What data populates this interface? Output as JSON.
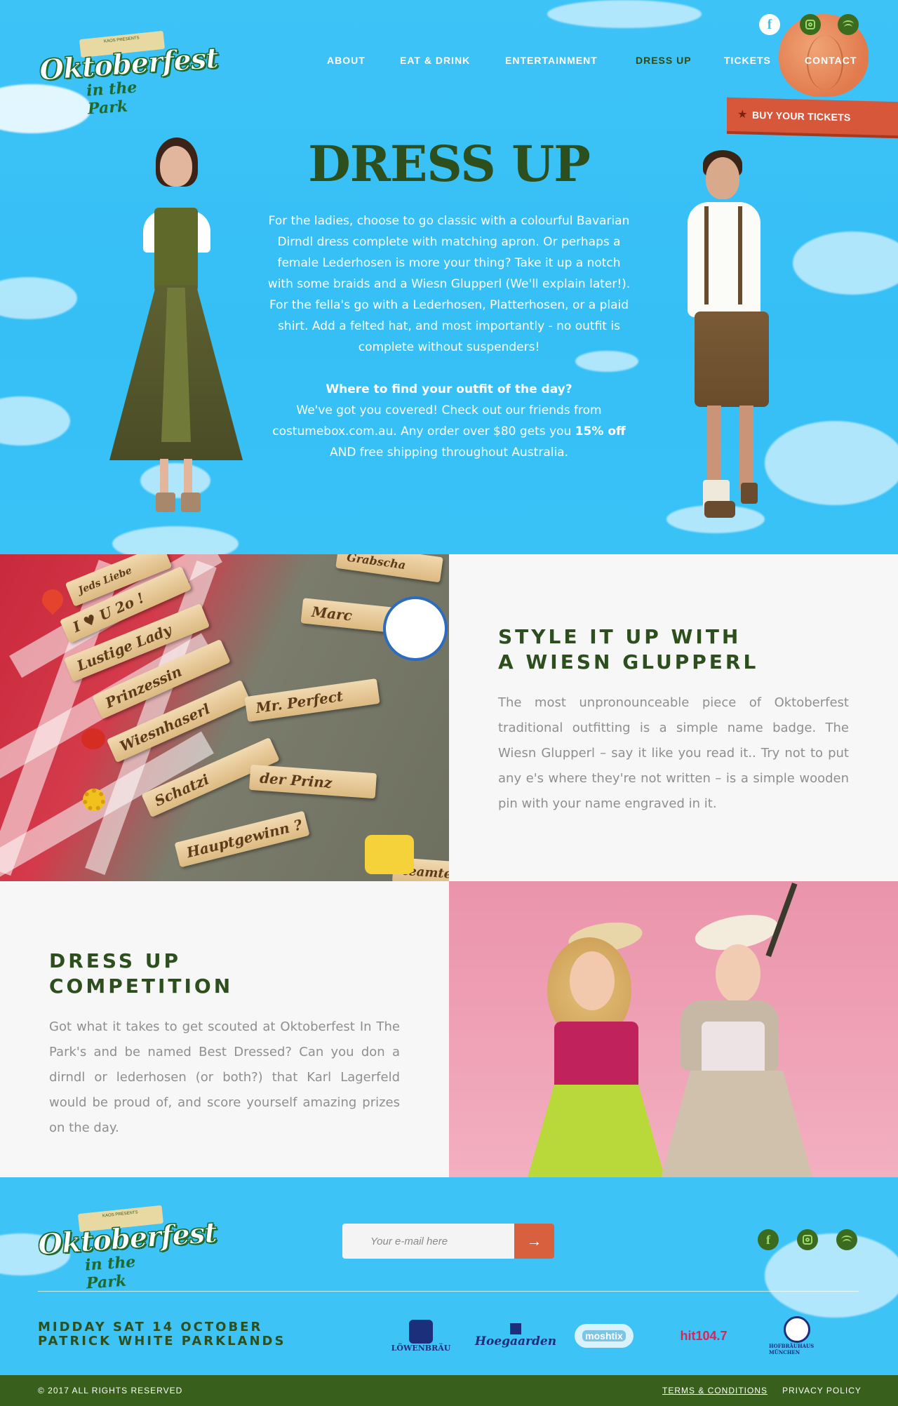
{
  "logo": {
    "brand_line": "KAOS PRESENTS",
    "word": "Oktoberfest",
    "sub": "in the Park"
  },
  "nav": {
    "items": [
      {
        "label": "ABOUT"
      },
      {
        "label": "EAT & DRINK"
      },
      {
        "label": "ENTERTAINMENT"
      },
      {
        "label": "DRESS UP"
      },
      {
        "label": "TICKETS"
      },
      {
        "label": "CONTACT"
      }
    ],
    "active": "DRESS UP",
    "buy_label": "BUY YOUR TICKETS"
  },
  "social": {
    "icons": [
      "facebook-icon",
      "instagram-icon",
      "spotify-icon"
    ],
    "facebook_glyph": "f"
  },
  "hero": {
    "title": "DRESS UP",
    "paragraph": "For the ladies, choose to go classic with a colourful Bavarian Dirndl dress complete with matching apron. Or perhaps a female Lederhosen is more your thing? Take it up a notch with some braids and a Wiesn Glupperl (We'll explain later!). For the fella's go with a Lederhosen, Platterhosen, or a plaid shirt. Add a felted hat, and most importantly - no outfit is complete without suspenders!",
    "question": "Where to find your outfit of the day?",
    "answer_1": "We've got you covered! Check out our friends from costumebox.com.au. Any order over $80 gets you ",
    "answer_bold": "15% off",
    "answer_2": " AND free shipping throughout Australia."
  },
  "section_glupperl": {
    "title_line1": "STYLE IT UP WITH",
    "title_line2": "A WIESN GLUPPERL",
    "body": "The most unpronounceable piece of Oktoberfest traditional outfitting is a simple name badge. The Wiesn Glupperl – say it like you read it.. Try not to put any e's where they're not written – is a simple wooden pin with your name engraved in it.",
    "pins": [
      "I ♥ U 2o !",
      "Lustige Lady",
      "Prinzessin",
      "Wiesnhaserl",
      "Schatzi",
      "Hauptgewinn ?",
      "Marc",
      "Mr. Perfect",
      "der Prinz",
      "Grabscha",
      "Jeds Liebe",
      "teamteam"
    ]
  },
  "section_competition": {
    "title_line1": "DRESS UP",
    "title_line2": "COMPETITION",
    "body": "Got what it takes to get scouted at Oktoberfest In The Park's and be named Best Dressed? Can you don a dirndl or lederhosen (or both?) that Karl Lagerfeld would be proud of, and score yourself amazing prizes on the day."
  },
  "footer": {
    "email_placeholder": "Your e-mail here",
    "submit_glyph": "→",
    "event_line1": "MIDDAY SAT 14 OCTOBER",
    "event_line2": "PATRICK WHITE PARKLANDS",
    "sponsors": [
      "LÖWENBRÄU",
      "Hoegaarden",
      "moshtix",
      "hit104.7",
      "HOFBRÄUHAUS MÜNCHEN"
    ],
    "copyright": "© 2017 ALL RIGHTS RESERVED",
    "terms": "TERMS & CONDITIONS",
    "privacy": "PRIVACY POLICY"
  },
  "colors": {
    "sky": "#3ec3f7",
    "dark_green": "#2c4f1d",
    "accent_orange": "#d7573a",
    "bottom_bar": "#385f1c"
  }
}
